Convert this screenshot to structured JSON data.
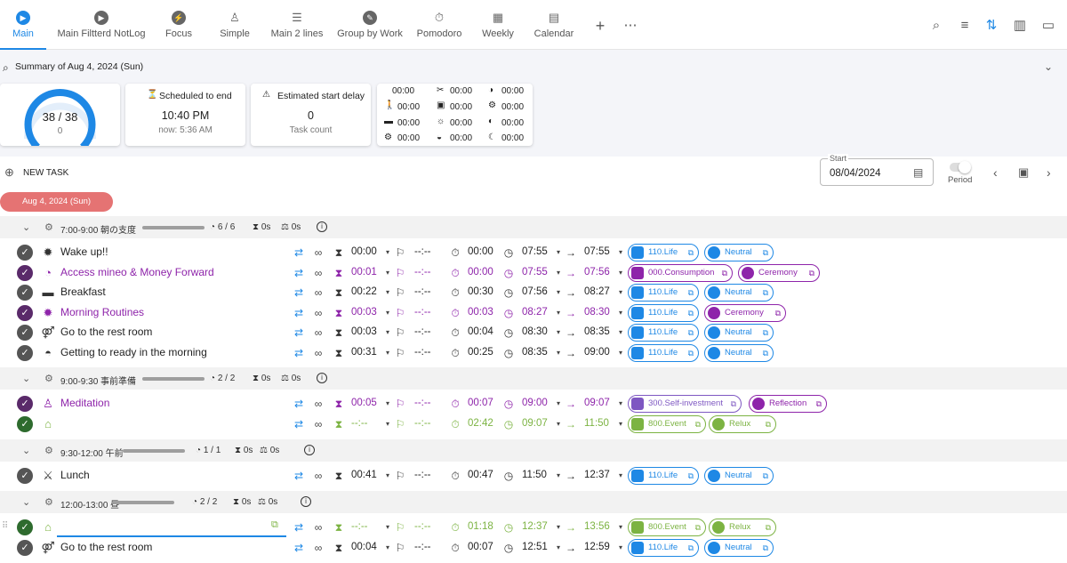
{
  "tabs": [
    {
      "label": "Main",
      "icon": "play-icon",
      "active": true
    },
    {
      "label": "Main Filtterd NotLog",
      "icon": "play-icon"
    },
    {
      "label": "Focus",
      "icon": "bolt-icon"
    },
    {
      "label": "Simple",
      "icon": "meditation-icon"
    },
    {
      "label": "Main 2 lines",
      "icon": "list-icon"
    },
    {
      "label": "Group by Work",
      "icon": "wrench-icon"
    },
    {
      "label": "Pomodoro",
      "icon": "stopwatch-icon"
    },
    {
      "label": "Weekly",
      "icon": "grid-icon"
    },
    {
      "label": "Calendar",
      "icon": "calendar-icon"
    }
  ],
  "summary": {
    "title": "Summary of Aug 4, 2024 (Sun)",
    "gauge": {
      "value": "38 / 38",
      "sub": "0",
      "progress": 1.0
    },
    "scheduled": {
      "label": "Scheduled to end",
      "time": "10:40 PM",
      "now": "now: 5:36 AM"
    },
    "delay": {
      "label": "Estimated start delay",
      "value": "0",
      "sub": "Task count"
    },
    "timers": [
      "00:00",
      "00:00",
      "00:00",
      "00:00",
      "00:00",
      "00:00",
      "00:00",
      "00:00",
      "00:00",
      "00:00",
      "00:00",
      "00:00"
    ]
  },
  "toolbar": {
    "new_task": "NEW TASK",
    "start_label": "Start",
    "start_value": "08/04/2024",
    "period": "Period",
    "date_chip": "Aug 4, 2024 (Sun)"
  },
  "groups": [
    {
      "label": "7:00-9:00 朝の支度",
      "count": "6 / 6",
      "est": "0s",
      "act": "0s"
    },
    {
      "label": "9:00-9:30 事前準備",
      "count": "2 / 2",
      "est": "0s",
      "act": "0s"
    },
    {
      "label": "9:30-12:00 午前",
      "count": "1 / 1",
      "est": "0s",
      "act": "0s"
    },
    {
      "label": "12:00-13:00 昼",
      "count": "2 / 2",
      "est": "0s",
      "act": "0s"
    }
  ],
  "tasks": [
    {
      "title": "Wake up!!",
      "icon": "sun-icon",
      "est": "00:00",
      "delay": "--:--",
      "act": "00:00",
      "start": "07:55",
      "end": "07:55",
      "project": "110.Life",
      "mode": "Neutral",
      "style": "normal"
    },
    {
      "title": "Access mineo & Money Forward",
      "icon": "check-circle-icon",
      "est": "00:01",
      "delay": "--:--",
      "act": "00:00",
      "start": "07:55",
      "end": "07:56",
      "project": "000.Consumption",
      "mode": "Ceremony",
      "style": "purple"
    },
    {
      "title": "Breakfast",
      "icon": "bread-icon",
      "est": "00:22",
      "delay": "--:--",
      "act": "00:30",
      "start": "07:56",
      "end": "08:27",
      "project": "110.Life",
      "mode": "Neutral",
      "style": "normal"
    },
    {
      "title": "Morning Routines",
      "icon": "sun-icon",
      "est": "00:03",
      "delay": "--:--",
      "act": "00:03",
      "start": "08:27",
      "end": "08:30",
      "project": "110.Life",
      "mode": "Ceremony",
      "style": "purple"
    },
    {
      "title": "Go to the rest room",
      "icon": "restroom-icon",
      "est": "00:03",
      "delay": "--:--",
      "act": "00:04",
      "start": "08:30",
      "end": "08:35",
      "project": "110.Life",
      "mode": "Neutral",
      "style": "normal"
    },
    {
      "title": "Getting to ready in the morning",
      "icon": "sunrise-icon",
      "est": "00:31",
      "delay": "--:--",
      "act": "00:25",
      "start": "08:35",
      "end": "09:00",
      "project": "110.Life",
      "mode": "Neutral",
      "style": "normal"
    },
    {
      "title": "Meditation",
      "icon": "meditation-icon",
      "est": "00:05",
      "delay": "--:--",
      "act": "00:07",
      "start": "09:00",
      "end": "09:07",
      "project": "300.Self-investment",
      "mode": "Reflection",
      "style": "purple"
    },
    {
      "title": "",
      "icon": "home-icon",
      "est": "--:--",
      "delay": "--:--",
      "act": "02:42",
      "start": "09:07",
      "end": "11:50",
      "project": "800.Event",
      "mode": "Relux",
      "style": "green"
    },
    {
      "title": "Lunch",
      "icon": "cutlery-icon",
      "est": "00:41",
      "delay": "--:--",
      "act": "00:47",
      "start": "11:50",
      "end": "12:37",
      "project": "110.Life",
      "mode": "Neutral",
      "style": "normal"
    },
    {
      "title": "",
      "icon": "home-icon",
      "est": "--:--",
      "delay": "--:--",
      "act": "01:18",
      "start": "12:37",
      "end": "13:56",
      "project": "800.Event",
      "mode": "Relux",
      "style": "green"
    },
    {
      "title": "Go to the rest room",
      "icon": "restroom-icon",
      "est": "00:04",
      "delay": "--:--",
      "act": "00:07",
      "start": "12:51",
      "end": "12:59",
      "project": "110.Life",
      "mode": "Neutral",
      "style": "normal"
    }
  ],
  "colors": {
    "accent": "#1e88e5",
    "purple": "#8e24aa",
    "green": "#7cb342",
    "chip": "#e57373"
  }
}
